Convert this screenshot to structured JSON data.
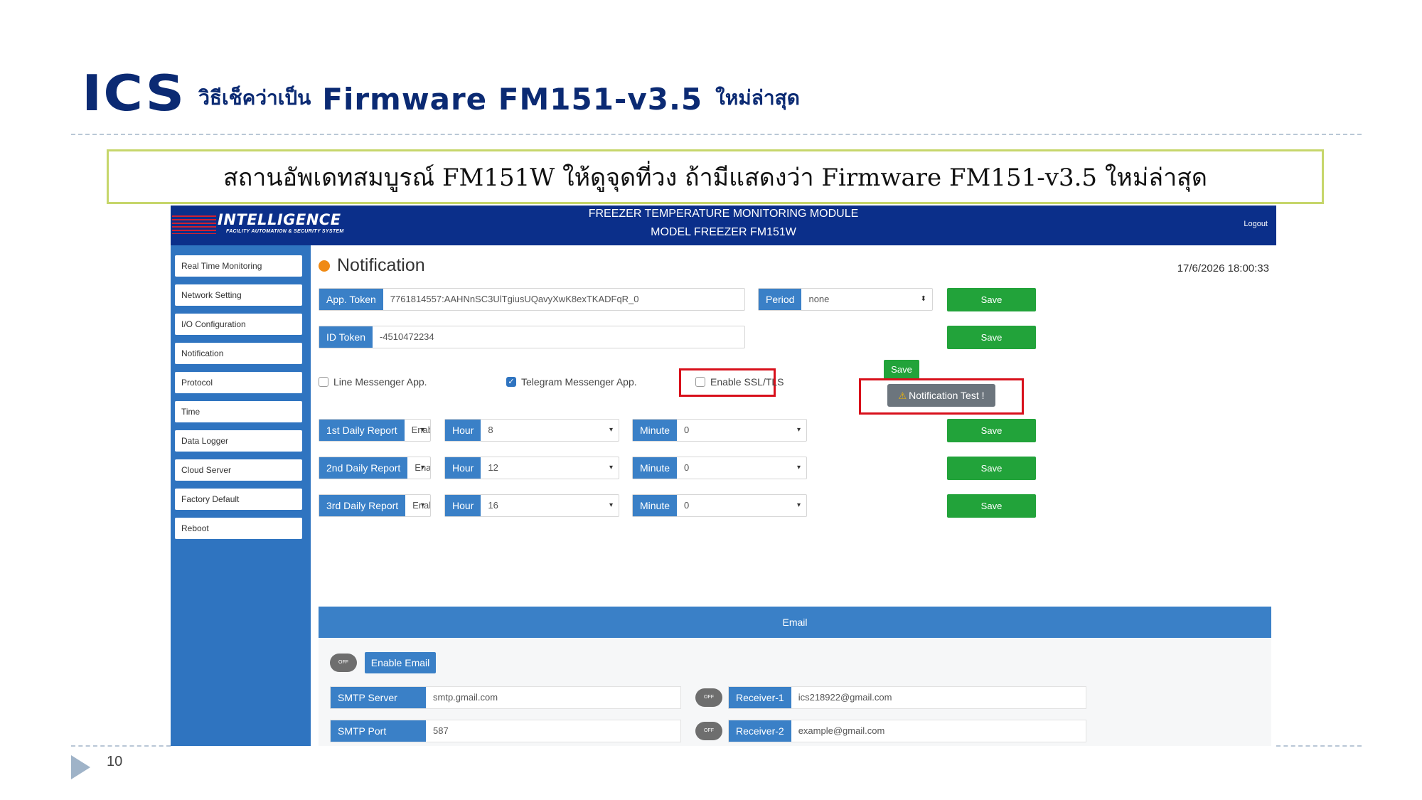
{
  "slide": {
    "logo": "ICS",
    "title_prefix": "วิธีเช็คว่าเป็น",
    "title_firmware": "Firmware FM151-v3.5",
    "title_suffix": "ใหม่ล่าสุด",
    "caption": "สถานอัพเดทสมบูรณ์ FM151W ให้ดูจุดที่วง ถ้ามีแสดงว่า Firmware FM151-v3.5 ใหม่ล่าสุด",
    "page_number": "10"
  },
  "app": {
    "logo_text": "INTELLIGENCE",
    "logo_subtitle": "FACILITY AUTOMATION & SECURITY SYSTEM",
    "title_line1": "FREEZER TEMPERATURE MONITORING MODULE",
    "title_line2": "MODEL FREEZER FM151W",
    "logout": "Logout"
  },
  "sidebar": {
    "items": [
      {
        "label": "Real Time Monitoring"
      },
      {
        "label": "Network Setting"
      },
      {
        "label": "I/O Configuration"
      },
      {
        "label": "Notification"
      },
      {
        "label": "Protocol"
      },
      {
        "label": "Time"
      },
      {
        "label": "Data Logger"
      },
      {
        "label": "Cloud Server"
      },
      {
        "label": "Factory Default"
      },
      {
        "label": "Reboot"
      }
    ]
  },
  "main": {
    "heading": "Notification",
    "datetime": "17/6/2026  18:00:33",
    "app_token_label": "App. Token",
    "app_token_value": "7761814557:AAHNnSC3UlTgiusUQavyXwK8exTKADFqR_0",
    "period_label": "Period",
    "period_value": "none",
    "id_token_label": "ID Token",
    "id_token_value": "-4510472234",
    "save_label": "Save",
    "line_label": "Line Messenger App.",
    "telegram_label": "Telegram Messenger App.",
    "ssl_label": "Enable SSL/TLS",
    "test_label": "Notification Test !",
    "reports": [
      {
        "label": "1st Daily Report",
        "status": "Enable",
        "hour_label": "Hour",
        "hour": "8",
        "minute_label": "Minute",
        "minute": "0"
      },
      {
        "label": "2nd Daily Report",
        "status": "Enable",
        "hour_label": "Hour",
        "hour": "12",
        "minute_label": "Minute",
        "minute": "0"
      },
      {
        "label": "3rd Daily Report",
        "status": "Enable",
        "hour_label": "Hour",
        "hour": "16",
        "minute_label": "Minute",
        "minute": "0"
      }
    ],
    "email": {
      "header": "Email",
      "toggle": "OFF",
      "enable_label": "Enable Email",
      "smtp_server_label": "SMTP Server",
      "smtp_server": "smtp.gmail.com",
      "smtp_port_label": "SMTP Port",
      "smtp_port": "587",
      "receiver1_label": "Receiver-1",
      "receiver1": "ics218922@gmail.com",
      "receiver2_label": "Receiver-2",
      "receiver2": "example@gmail.com"
    }
  }
}
